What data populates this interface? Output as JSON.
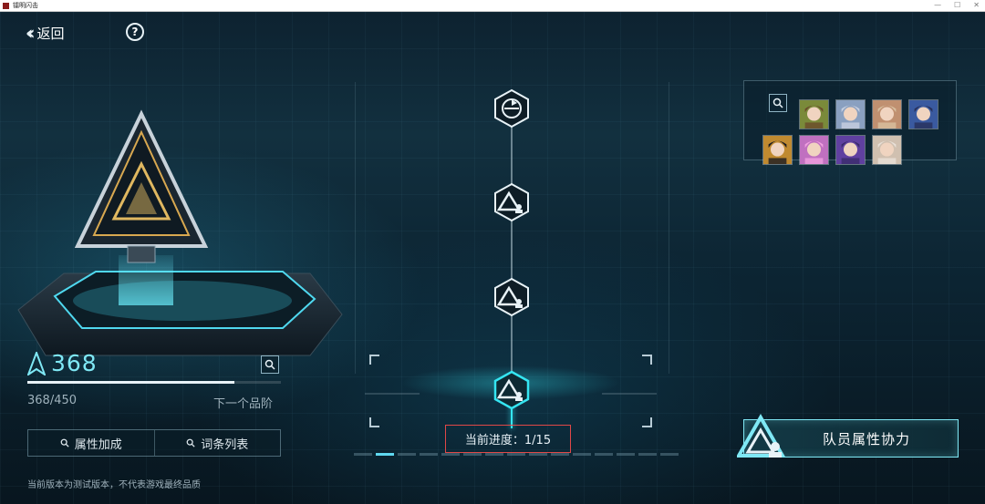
{
  "window": {
    "title": "镭明闪击",
    "controls": [
      "—",
      "☐",
      "✕"
    ]
  },
  "nav": {
    "back_label": "返回",
    "help_label": "?"
  },
  "score": {
    "value": "368",
    "progress_text": "368/450",
    "progress_fraction": 0.8178,
    "next_tier_label": "下一个品阶"
  },
  "tabs": [
    {
      "label": "属性加成",
      "icon": "search-icon"
    },
    {
      "label": "词条列表",
      "icon": "search-icon"
    }
  ],
  "footer_note": "当前版本为测试版本，不代表游戏最终品质",
  "path": {
    "nodes": [
      {
        "icon": "reset-icon",
        "state": "normal"
      },
      {
        "icon": "tier-icon",
        "state": "normal"
      },
      {
        "icon": "tier-icon",
        "state": "normal"
      },
      {
        "icon": "tier-icon",
        "state": "active"
      }
    ],
    "progress_label": "当前进度：1/15",
    "pages_total": 15,
    "page_current": 1
  },
  "team": {
    "search_icon": "search-icon",
    "members": [
      {
        "color": "#7a8a3a",
        "hair": "#6b4a2a"
      },
      {
        "color": "#8aa0c0",
        "hair": "#c8d0e0"
      },
      {
        "color": "#c09070",
        "hair": "#d8c0a0"
      },
      {
        "color": "#3a5aa0",
        "hair": "#28305a"
      },
      {
        "color": "#c08a30",
        "hair": "#1a1a22"
      },
      {
        "color": "#c070c0",
        "hair": "#f0a0e0"
      },
      {
        "color": "#6040a0",
        "hair": "#3a2a6a"
      },
      {
        "color": "#d0c0b0",
        "hair": "#e8e0d8"
      }
    ]
  },
  "coop_button": {
    "label": "队员属性协力"
  },
  "colors": {
    "accent": "#35e6f2",
    "highlight_box": "#e04848"
  }
}
